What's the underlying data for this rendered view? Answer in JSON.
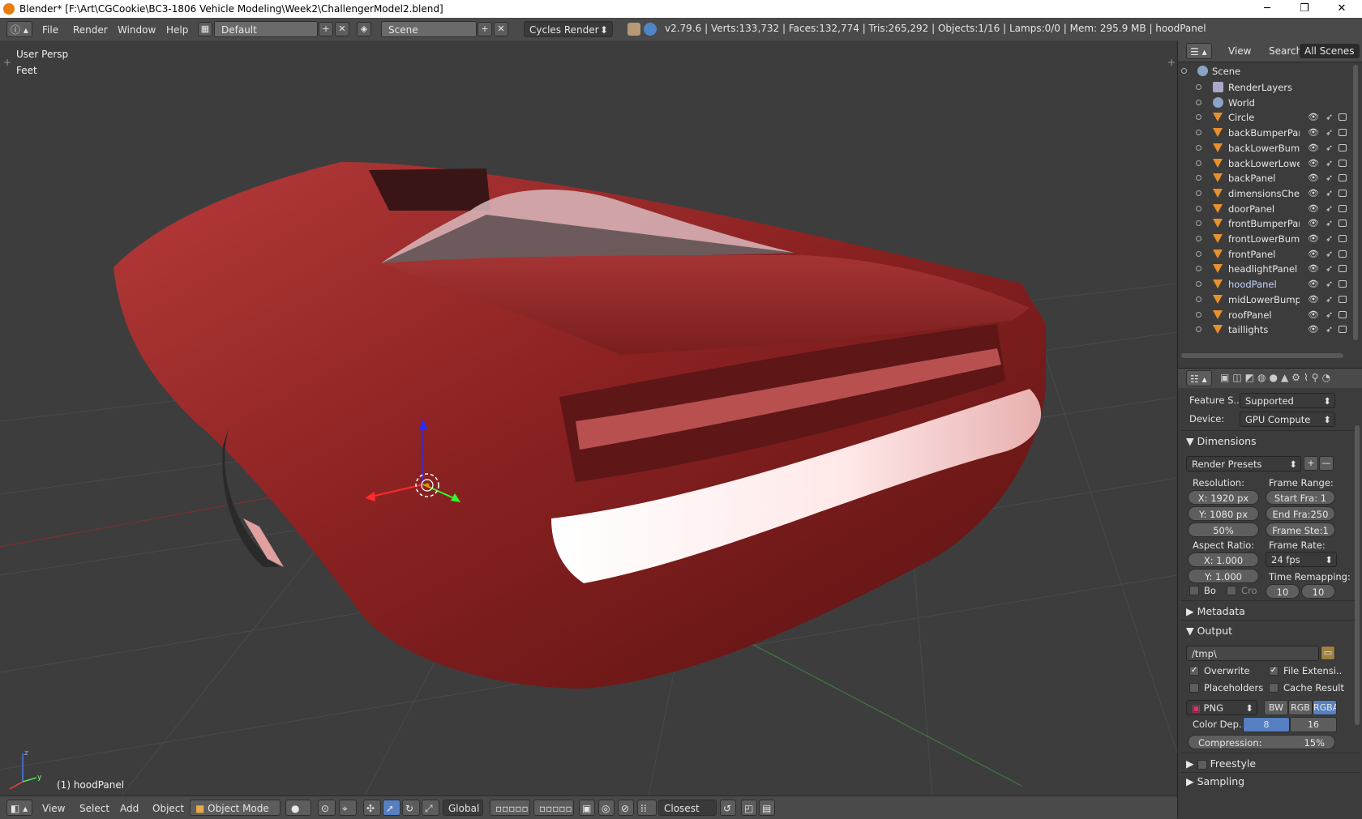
{
  "window": {
    "title": "Blender* [F:\\Art\\CGCookie\\BC3-1806 Vehicle Modeling\\Week2\\ChallengerModel2.blend]",
    "minimize": "─",
    "maximize": "❐",
    "close": "✕"
  },
  "infobar": {
    "menus": [
      "File",
      "Render",
      "Window",
      "Help"
    ],
    "screen_layout": "Default",
    "scene": "Scene",
    "render_engine": "Cycles Render",
    "stats": "v2.79.6 | Verts:133,732 | Faces:132,774 | Tris:265,292 | Objects:1/16 | Lamps:0/0 | Mem: 295.9 MB | hoodPanel"
  },
  "viewport": {
    "view_name": "User Persp",
    "units": "Feet",
    "active_object": "(1) hoodPanel"
  },
  "header3d": {
    "menus": [
      "View",
      "Select",
      "Add",
      "Object"
    ],
    "mode": "Object Mode",
    "orientation": "Global",
    "snap": "Closest"
  },
  "outliner": {
    "tabs": [
      "View",
      "Search",
      "All Scenes"
    ],
    "root": "Scene",
    "items": [
      {
        "name": "RenderLayers",
        "type": "layers"
      },
      {
        "name": "World",
        "type": "world"
      },
      {
        "name": "Circle",
        "type": "mesh"
      },
      {
        "name": "backBumperPanel",
        "type": "mesh"
      },
      {
        "name": "backLowerBumpe",
        "type": "mesh"
      },
      {
        "name": "backLowerLower",
        "type": "mesh"
      },
      {
        "name": "backPanel",
        "type": "mesh"
      },
      {
        "name": "dimensionsCheck",
        "type": "mesh"
      },
      {
        "name": "doorPanel",
        "type": "mesh"
      },
      {
        "name": "frontBumperPane",
        "type": "mesh"
      },
      {
        "name": "frontLowerBumpe",
        "type": "mesh"
      },
      {
        "name": "frontPanel",
        "type": "mesh"
      },
      {
        "name": "headlightPanel",
        "type": "mesh"
      },
      {
        "name": "hoodPanel",
        "type": "mesh",
        "selected": true
      },
      {
        "name": "midLowerBumper",
        "type": "mesh"
      },
      {
        "name": "roofPanel",
        "type": "mesh"
      },
      {
        "name": "taillights",
        "type": "mesh"
      }
    ]
  },
  "properties": {
    "feature_set_label": "Feature S..",
    "feature_set": "Supported",
    "device_label": "Device:",
    "device": "GPU Compute",
    "dimensions": {
      "title": "Dimensions",
      "presets": "Render Presets",
      "resolution_label": "Resolution:",
      "res_x": "X:  1920 px",
      "res_y": "Y:  1080 px",
      "res_pct": "50%",
      "frame_range_label": "Frame Range:",
      "start": "Start Fra:  1",
      "end": "End Fra:250",
      "step": "Frame Ste:1",
      "aspect_label": "Aspect Ratio:",
      "aspect_x": "X:      1.000",
      "aspect_y": "Y:      1.000",
      "frame_rate_label": "Frame Rate:",
      "frame_rate": "24 fps",
      "time_remap_label": "Time Remapping:",
      "remap_old": "10",
      "remap_new": "10",
      "border": "Bo",
      "crop": "Cro"
    },
    "metadata_title": "Metadata",
    "output": {
      "title": "Output",
      "path": "/tmp\\",
      "overwrite": "Overwrite",
      "file_ext": "File Extensi..",
      "placeholders": "Placeholders",
      "cache_result": "Cache Result",
      "format": "PNG",
      "bw": "BW",
      "rgb": "RGB",
      "rgba": "RGBA",
      "color_depth_label": "Color Dep..",
      "depth_8": "8",
      "depth_16": "16",
      "compression": "Compression:",
      "compression_value": "15%"
    },
    "freestyle_title": "Freestyle",
    "sampling_title": "Sampling"
  }
}
